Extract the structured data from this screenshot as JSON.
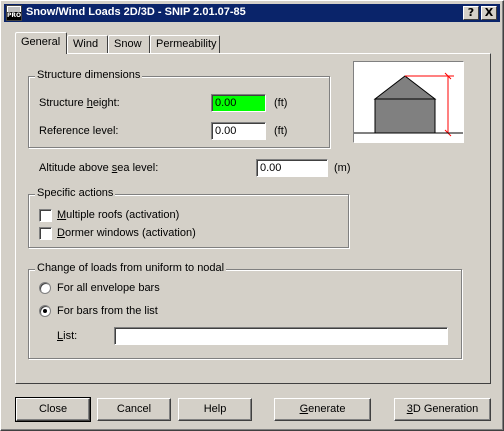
{
  "window": {
    "title": "Snow/Wind Loads 2D/3D - SNIP 2.01.07-85",
    "icon_text": "PRO",
    "help_button": "?",
    "close_button": "X"
  },
  "tabs": [
    {
      "label": "General",
      "active": true
    },
    {
      "label": "Wind",
      "active": false
    },
    {
      "label": "Snow",
      "active": false
    },
    {
      "label": "Permeability",
      "active": false
    }
  ],
  "structure_dimensions": {
    "title": "Structure dimensions",
    "height_label_pre": "Structure ",
    "height_label_u": "h",
    "height_label_post": "eight:",
    "height_value": "0.00",
    "height_unit": "(ft)",
    "reference_label": "Reference level:",
    "reference_value": "0.00",
    "reference_unit": "(ft)"
  },
  "altitude": {
    "label_pre": "Altitude above ",
    "label_u": "s",
    "label_post": "ea level:",
    "value": "0.00",
    "unit": "(m)"
  },
  "specific_actions": {
    "title": "Specific actions",
    "multiple_roofs_u": "M",
    "multiple_roofs_rest": "ultiple roofs (activation)",
    "multiple_roofs_checked": false,
    "dormer_u": "D",
    "dormer_rest": "ormer windows (activation)",
    "dormer_checked": false
  },
  "loads": {
    "title": "Change of loads from uniform to nodal",
    "all_bars_label": "For all envelope bars",
    "all_bars_selected": false,
    "list_bars_label": "For bars from the list",
    "list_bars_selected": true,
    "list_label_u": "L",
    "list_label_rest": "ist:",
    "list_value": ""
  },
  "buttons": {
    "close": "Close",
    "cancel": "Cancel",
    "help": "Help",
    "generate_u": "G",
    "generate_rest": "enerate",
    "generation_3d_u": "3",
    "generation_3d_rest": "D Generation"
  },
  "colors": {
    "titlebar": "#0a246a",
    "highlight_field": "#00ff00",
    "dimension_line": "#ff0000",
    "house_fill": "#808080"
  }
}
